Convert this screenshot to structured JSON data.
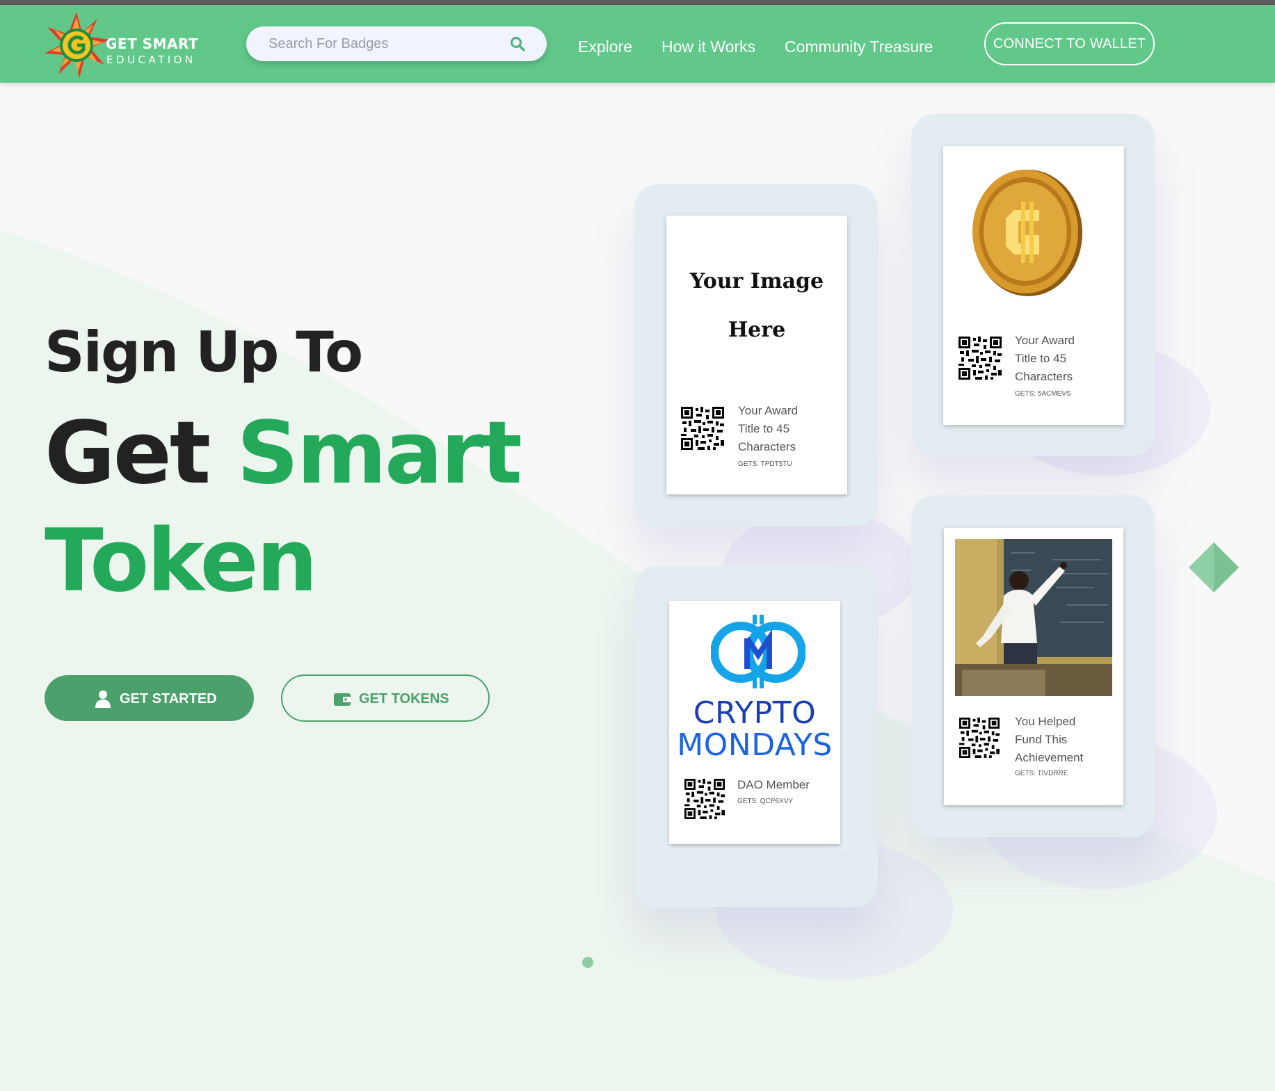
{
  "brand": {
    "line1": "GET SMART",
    "line2": "EDUCATION",
    "colors": {
      "nav": "#62c88a",
      "accent": "#24a85a",
      "button": "#4ba06c"
    }
  },
  "search": {
    "placeholder": "Search For Badges",
    "value": "",
    "icon": "search-icon"
  },
  "nav": {
    "explore": "Explore",
    "how_it_works": "How it Works",
    "community_treasure": "Community Treasure",
    "connect_wallet": "CONNECT TO WALLET"
  },
  "hero": {
    "line1": "Sign Up To",
    "line2_a": "Get",
    "line2_b": "Smart",
    "line3": "Token",
    "get_started": "GET STARTED",
    "get_tokens": "GET TOKENS"
  },
  "badges": {
    "placeholder": {
      "image_line1": "Your Image",
      "image_line2": "Here",
      "title": "Your Award Title to 45 Characters",
      "code": "GETS: TPDT5TU"
    },
    "coin": {
      "title": "Your Award Title to 45 Characters",
      "code": "GETS: 5ACMEVS"
    },
    "crypto_mondays": {
      "line1": "CRYPTO",
      "line2": "MONDAYS",
      "title": "DAO Member",
      "code": "GETS: QCP6XVY"
    },
    "teacher": {
      "title": "You Helped Fund This Achievement",
      "code": "GETS: TIVDRRE"
    }
  }
}
